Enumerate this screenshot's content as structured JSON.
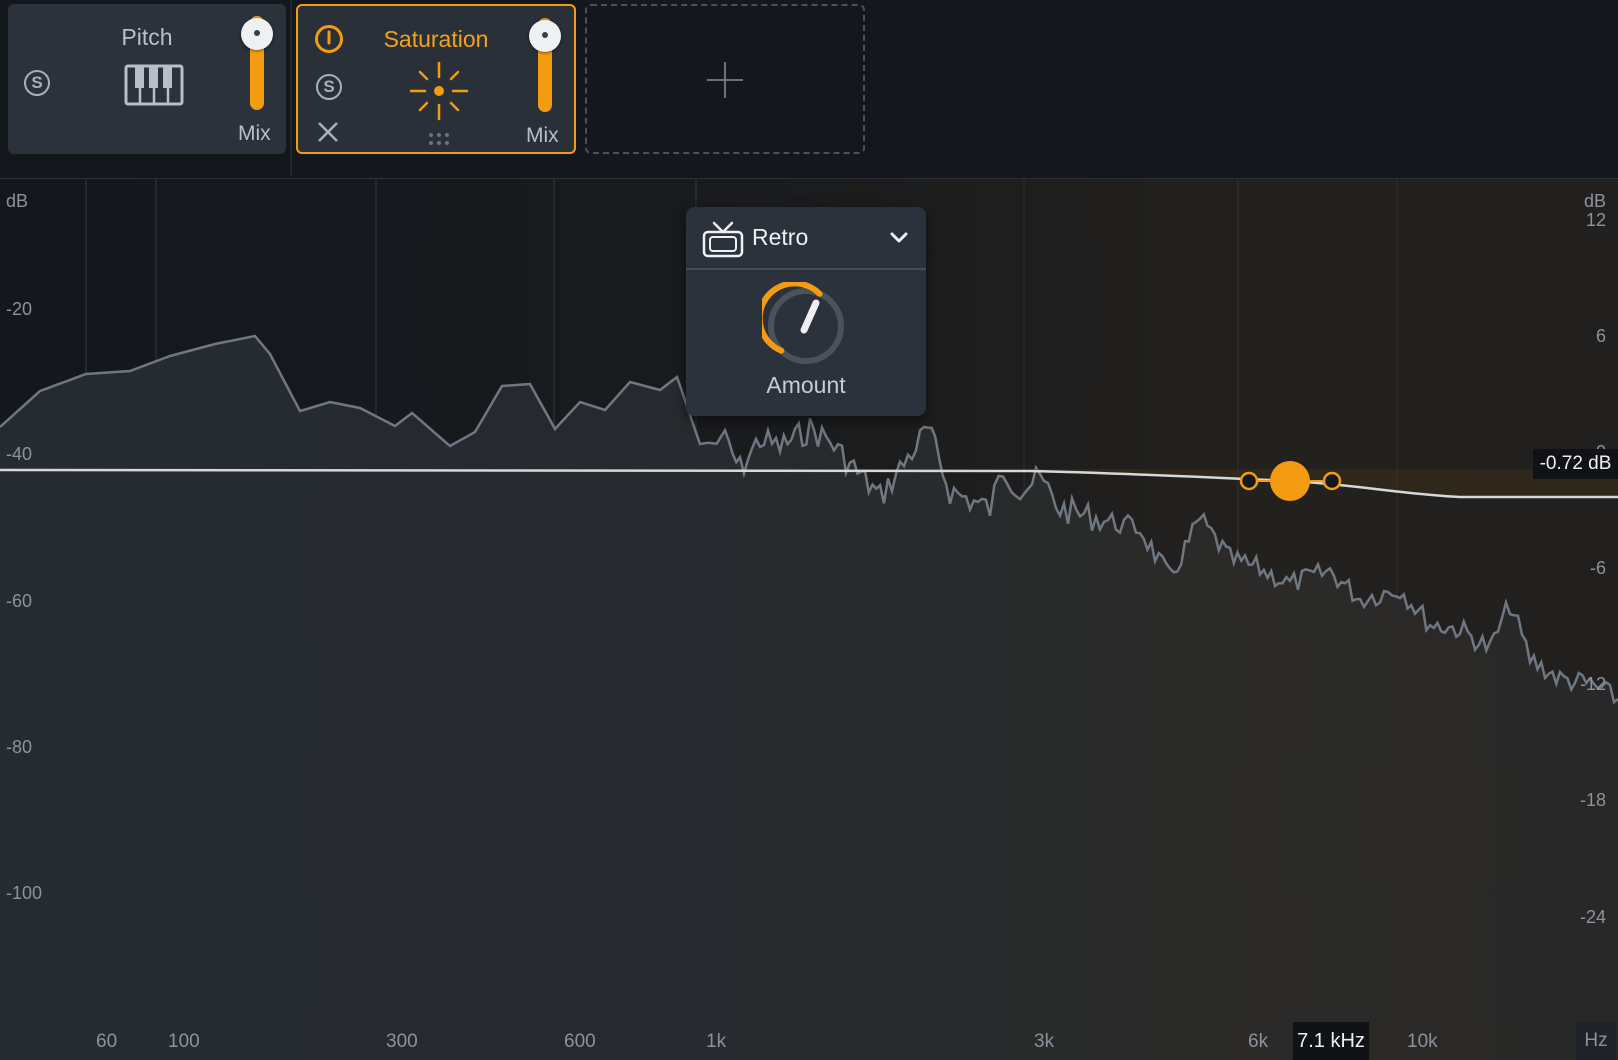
{
  "modules": [
    {
      "name": "Pitch",
      "mix_label": "Mix",
      "selected": false
    },
    {
      "name": "Saturation",
      "mix_label": "Mix",
      "selected": true
    }
  ],
  "icons": {
    "solo": "S",
    "pitch": "piano-keys-icon",
    "saturation": "sun-burst-icon",
    "power": "power-icon",
    "close": "close-icon",
    "drag": "drag-handle-icon",
    "add": "plus-icon",
    "preset": "retro-tv-icon",
    "dropdown": "chevron-down-icon"
  },
  "colors": {
    "accent": "#f39c12",
    "background": "#14171c",
    "panel": "#2b323b",
    "spectrum_line": "#6f7882",
    "eq_line": "#d6d8da"
  },
  "popup": {
    "preset": "Retro",
    "knob_label": "Amount"
  },
  "graph": {
    "db_left_unit": "dB",
    "db_left": [
      "-20",
      "-40",
      "-60",
      "-80",
      "-100"
    ],
    "db_right_unit": "dB",
    "db_right": [
      "12",
      "6",
      "0",
      "-6",
      "-12",
      "-18",
      "-24"
    ],
    "freq_labels": [
      "60",
      "100",
      "300",
      "600",
      "1k",
      "3k",
      "6k",
      "10k"
    ],
    "freq_unit": "Hz",
    "gain_readout": "-0.72 dB",
    "freq_readout": "7.1 kHz"
  }
}
